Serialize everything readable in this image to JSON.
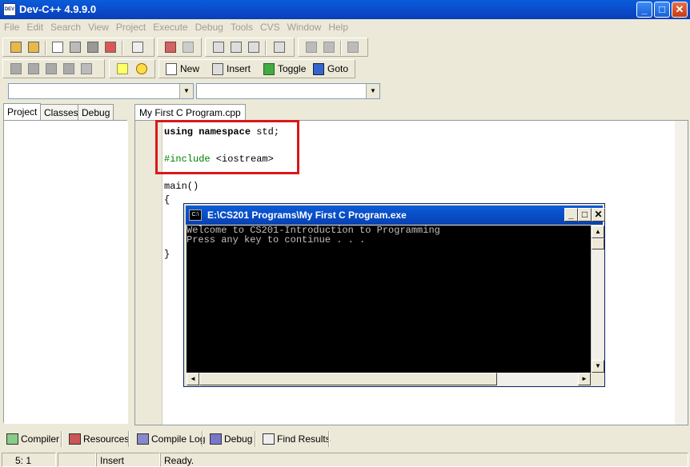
{
  "window": {
    "title": "Dev-C++ 4.9.9.0",
    "icon_label": "DEV"
  },
  "menu": [
    "File",
    "Edit",
    "Search",
    "View",
    "Project",
    "Execute",
    "Debug",
    "Tools",
    "CVS",
    "Window",
    "Help"
  ],
  "toolbar2": {
    "new_label": "New",
    "insert_label": "Insert",
    "toggle_label": "Toggle",
    "goto_label": "Goto"
  },
  "left_tabs": [
    "Project",
    "Classes",
    "Debug"
  ],
  "editor": {
    "tab_label": "My First C Program.cpp",
    "code": [
      {
        "kw": "using namespace",
        "rest": " std;"
      },
      {
        "kw": "",
        "rest": ""
      },
      {
        "pp": "#include",
        "rest": " <iostream>"
      },
      {
        "kw": "",
        "rest": ""
      },
      {
        "kw": "",
        "rest": "main()"
      },
      {
        "kw": "",
        "rest": "{"
      },
      {
        "kw": "",
        "rest": ""
      },
      {
        "kw": "",
        "rest": ""
      },
      {
        "kw": "",
        "rest": ""
      },
      {
        "kw": "",
        "rest": "}"
      }
    ]
  },
  "console": {
    "title": "E:\\CS201 Programs\\My First C Program.exe",
    "icon_label": "C:\\",
    "lines": [
      "Welcome to CS201-Introduction to Programming",
      "Press any key to continue . . ."
    ]
  },
  "bottom_tabs": [
    "Compiler",
    "Resources",
    "Compile Log",
    "Debug",
    "Find Results"
  ],
  "status": {
    "position": "5: 1",
    "mode": "Insert",
    "message": "Ready."
  }
}
